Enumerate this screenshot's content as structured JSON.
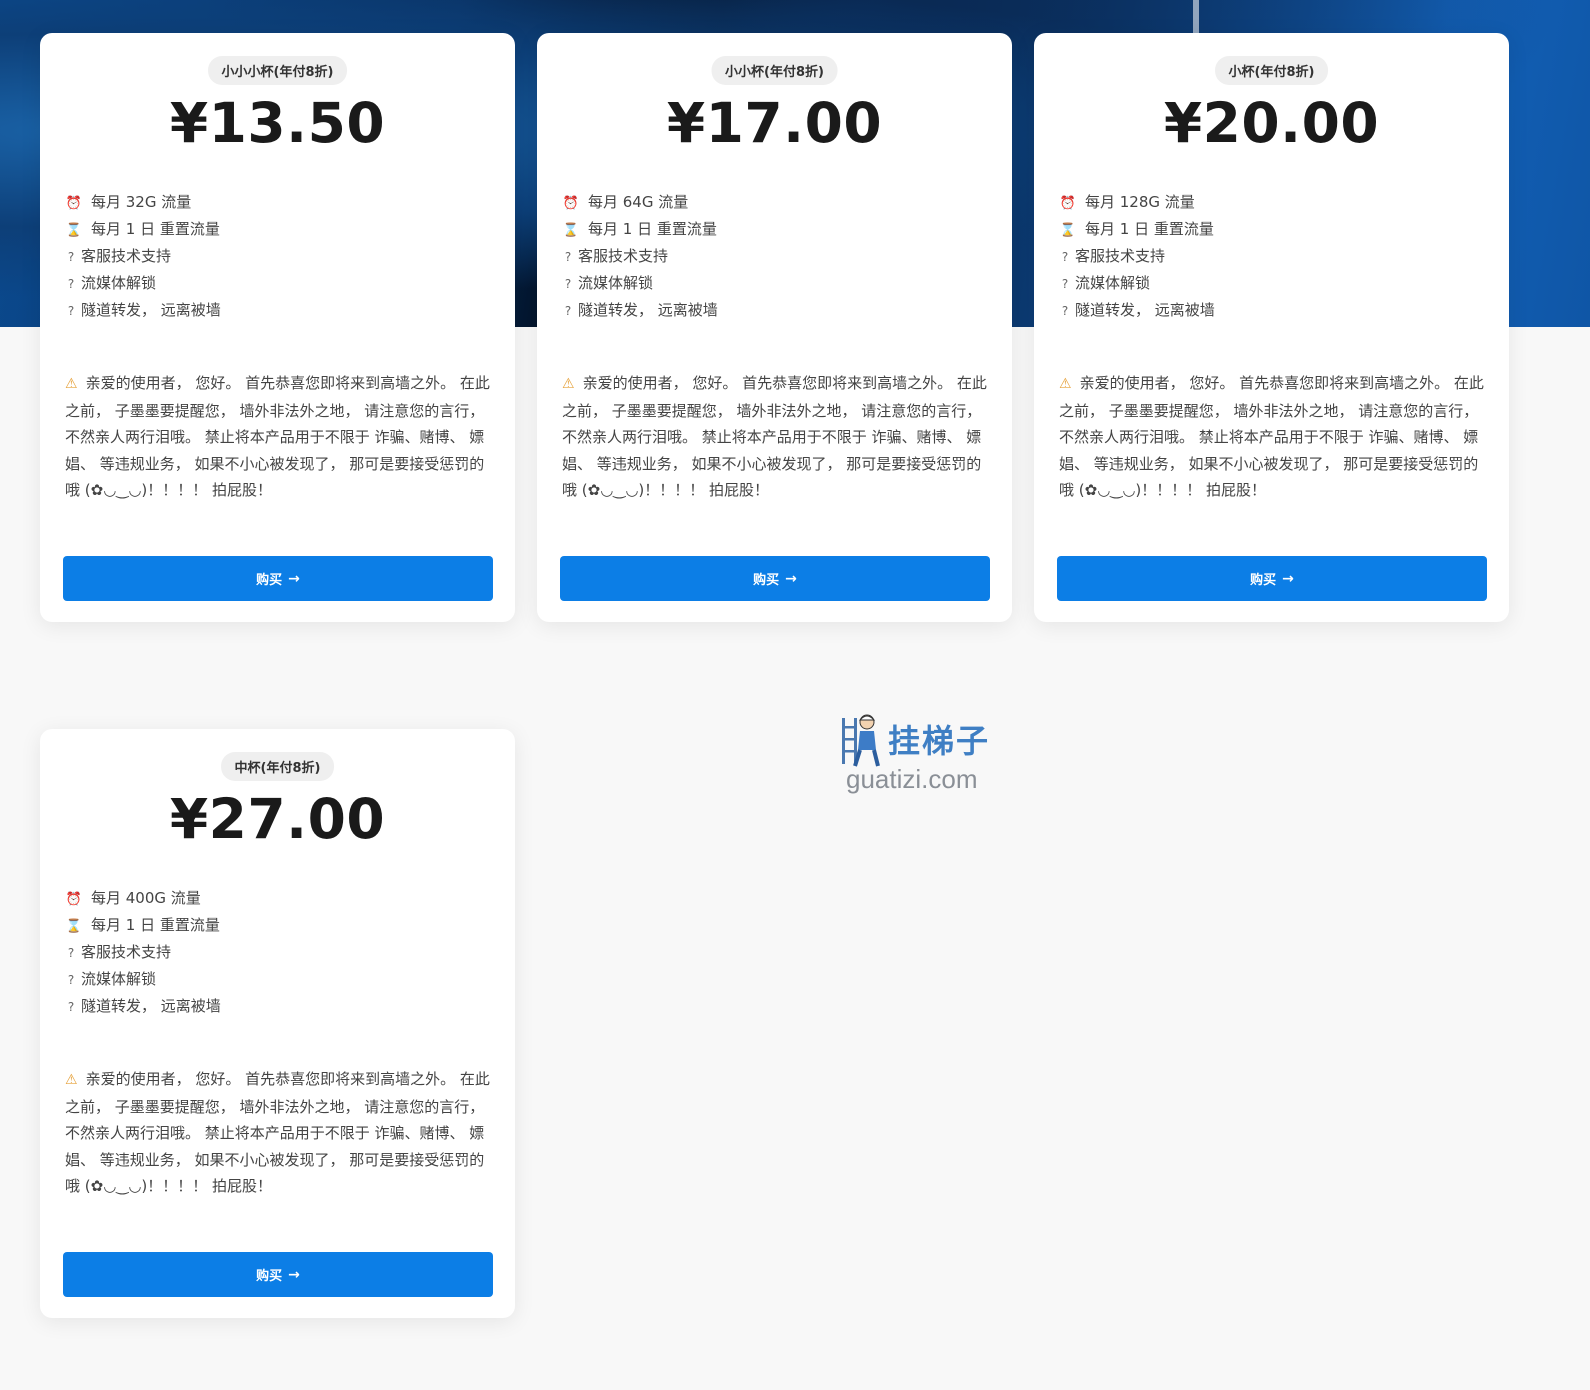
{
  "plans": [
    {
      "tag": "小小小杯(年付8折)",
      "price": "¥13.50",
      "features": {
        "traffic": "每月 32G 流量",
        "reset": "每月 1 日 重置流量",
        "support": "客服技术支持",
        "streaming": "流媒体解锁",
        "tunnel": "隧道转发， 远离被墙"
      },
      "notice": "亲爱的使用者， 您好。 首先恭喜您即将来到高墙之外。 在此之前， 子墨墨要提醒您， 墙外非法外之地， 请注意您的言行， 不然亲人两行泪哦。 禁止将本产品用于不限于 诈骗、赌博、 嫖娼、 等违规业务， 如果不小心被发现了， 那可是要接受惩罚的哦 (✿◡‿◡)！！！！ 拍屁股！",
      "buy_label": "购买"
    },
    {
      "tag": "小小杯(年付8折)",
      "price": "¥17.00",
      "features": {
        "traffic": "每月 64G 流量",
        "reset": "每月 1 日 重置流量",
        "support": "客服技术支持",
        "streaming": "流媒体解锁",
        "tunnel": "隧道转发， 远离被墙"
      },
      "notice": "亲爱的使用者， 您好。 首先恭喜您即将来到高墙之外。 在此之前， 子墨墨要提醒您， 墙外非法外之地， 请注意您的言行， 不然亲人两行泪哦。 禁止将本产品用于不限于 诈骗、赌博、 嫖娼、 等违规业务， 如果不小心被发现了， 那可是要接受惩罚的哦 (✿◡‿◡)！！！！ 拍屁股！",
      "buy_label": "购买"
    },
    {
      "tag": "小杯(年付8折)",
      "price": "¥20.00",
      "features": {
        "traffic": "每月 128G 流量",
        "reset": "每月 1 日 重置流量",
        "support": "客服技术支持",
        "streaming": "流媒体解锁",
        "tunnel": "隧道转发， 远离被墙"
      },
      "notice": "亲爱的使用者， 您好。 首先恭喜您即将来到高墙之外。 在此之前， 子墨墨要提醒您， 墙外非法外之地， 请注意您的言行， 不然亲人两行泪哦。 禁止将本产品用于不限于 诈骗、赌博、 嫖娼、 等违规业务， 如果不小心被发现了， 那可是要接受惩罚的哦 (✿◡‿◡)！！！！ 拍屁股！",
      "buy_label": "购买"
    },
    {
      "tag": "中杯(年付8折)",
      "price": "¥27.00",
      "features": {
        "traffic": "每月 400G 流量",
        "reset": "每月 1 日 重置流量",
        "support": "客服技术支持",
        "streaming": "流媒体解锁",
        "tunnel": "隧道转发， 远离被墙"
      },
      "notice": "亲爱的使用者， 您好。 首先恭喜您即将来到高墙之外。 在此之前， 子墨墨要提醒您， 墙外非法外之地， 请注意您的言行， 不然亲人两行泪哦。 禁止将本产品用于不限于 诈骗、赌博、 嫖娼、 等违规业务， 如果不小心被发现了， 那可是要接受惩罚的哦 (✿◡‿◡)！！！！ 拍屁股！",
      "buy_label": "购买"
    }
  ],
  "icons": {
    "traffic": "alarm-clock-icon",
    "reset": "hourglass-icon",
    "feature_generic": "question-mark-icon",
    "notice": "warning-icon",
    "buy": "arrow-right-icon"
  },
  "watermark": {
    "name": "挂梯子",
    "domain": "guatizi.com"
  },
  "colors": {
    "buy_button": "#0c7ee6",
    "watermark_text": "#3f7fc4",
    "page_background": "#f8f8f8"
  }
}
